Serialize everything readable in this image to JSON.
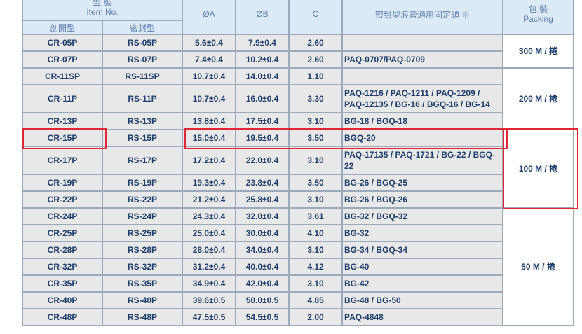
{
  "header": {
    "item_no_zh": "型 號",
    "item_no_en": "Item No.",
    "split_type": "剖開型",
    "sealed_type": "密封型",
    "col_a": "ØA",
    "col_b": "ØB",
    "col_c": "C",
    "fitting_note": "密封型浪管適用固定頭 ※",
    "packing_zh": "包 裝",
    "packing_en": "Packing"
  },
  "rows": [
    {
      "split": "CR-05P",
      "sealed": "RS-05P",
      "a": "5.6±0.4",
      "b": "7.9±0.4",
      "c": "2.60",
      "fit": ""
    },
    {
      "split": "CR-07P",
      "sealed": "RS-07P",
      "a": "7.4±0.4",
      "b": "10.2±0.4",
      "c": "2.60",
      "fit": "PAQ-0707/PAQ-0709"
    },
    {
      "split": "CR-11SP",
      "sealed": "RS-11SP",
      "a": "10.7±0.4",
      "b": "14.0±0.4",
      "c": "1.10",
      "fit": ""
    },
    {
      "split": "CR-11P",
      "sealed": "RS-11P",
      "a": "10.7±0.4",
      "b": "16.0±0.4",
      "c": "3.30",
      "fit": "PAQ-1216 / PAQ-1211 / PAQ-1209 / PAQ-12135 / BG-16 / BGQ-16 / BG-14"
    },
    {
      "split": "CR-13P",
      "sealed": "RS-13P",
      "a": "13.8±0.4",
      "b": "17.5±0.4",
      "c": "3.10",
      "fit": "BG-18 / BGQ-18"
    },
    {
      "split": "CR-15P",
      "sealed": "RS-15P",
      "a": "15.0±0.4",
      "b": "19.5±0.4",
      "c": "3.50",
      "fit": "BGQ-20"
    },
    {
      "split": "CR-17P",
      "sealed": "RS-17P",
      "a": "17.2±0.4",
      "b": "22.0±0.4",
      "c": "3.10",
      "fit": "PAQ-17135 / PAQ-1721 / BG-22 / BGQ-22"
    },
    {
      "split": "CR-19P",
      "sealed": "RS-19P",
      "a": "19.3±0.4",
      "b": "23.8±0.4",
      "c": "3.50",
      "fit": "BG-26 / BGQ-25"
    },
    {
      "split": "CR-22P",
      "sealed": "RS-22P",
      "a": "21.2±0.4",
      "b": "25.8±0.4",
      "c": "3.10",
      "fit": "BG-26 / BGQ-26"
    },
    {
      "split": "CR-24P",
      "sealed": "RS-24P",
      "a": "24.3±0.4",
      "b": "32.0±0.4",
      "c": "3.61",
      "fit": "BG-32 / BGQ-32"
    },
    {
      "split": "CR-25P",
      "sealed": "RS-25P",
      "a": "25.0±0.4",
      "b": "30.0±0.4",
      "c": "4.10",
      "fit": "BG-32"
    },
    {
      "split": "CR-28P",
      "sealed": "RS-28P",
      "a": "28.0±0.4",
      "b": "34.0±0.4",
      "c": "3.10",
      "fit": "BG-34 / BGQ-34"
    },
    {
      "split": "CR-32P",
      "sealed": "RS-32P",
      "a": "31.2±0.4",
      "b": "40.0±0.4",
      "c": "4.12",
      "fit": "BG-40"
    },
    {
      "split": "CR-35P",
      "sealed": "RS-35P",
      "a": "34.9±0.4",
      "b": "42.0±0.4",
      "c": "3.10",
      "fit": "BG-42"
    },
    {
      "split": "CR-40P",
      "sealed": "RS-40P",
      "a": "39.6±0.5",
      "b": "50.0±0.5",
      "c": "4.85",
      "fit": "BG-48 / BG-50"
    },
    {
      "split": "CR-48P",
      "sealed": "RS-48P",
      "a": "47.5±0.5",
      "b": "54.5±0.5",
      "c": "2.00",
      "fit": "PAQ-4848"
    }
  ],
  "packing": [
    {
      "label": "300 M / 捲"
    },
    {
      "label": "200 M / 捲"
    },
    {
      "label": "100 M / 捲"
    },
    {
      "label": "50 M / 捲"
    }
  ],
  "highlight_color": "#e32636",
  "header_bg": "#dce9f6",
  "cell_bg": "#e8e8e8",
  "text_color": "#1d3f6e"
}
